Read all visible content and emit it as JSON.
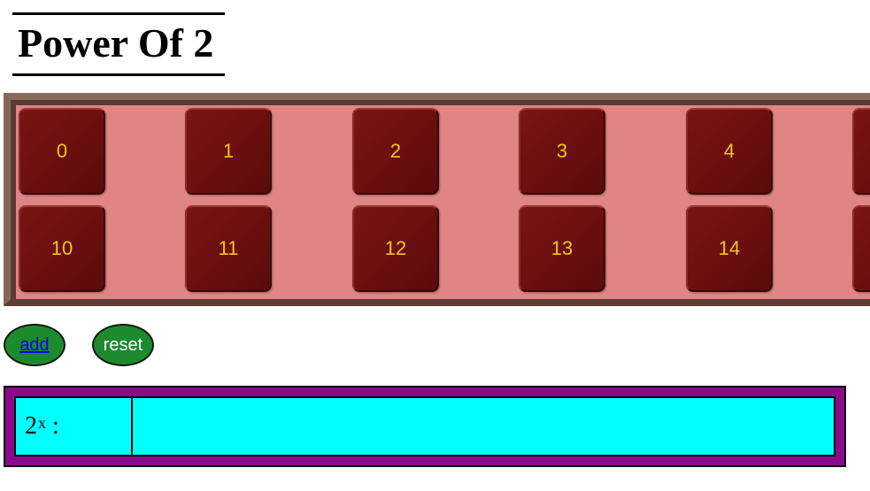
{
  "title": "Power Of 2",
  "grid": {
    "row1": [
      "0",
      "1",
      "2",
      "3",
      "4",
      ""
    ],
    "row2": [
      "10",
      "11",
      "12",
      "13",
      "14",
      ""
    ]
  },
  "buttons": {
    "add_label": "add",
    "reset_label": "reset"
  },
  "result": {
    "base": "2",
    "exponent": "x",
    "separator": " :",
    "value": ""
  },
  "colors": {
    "panel_background": "#e08585",
    "cell_background": "#6a0f0f",
    "cell_text": "#f5c51a",
    "button_background": "#1d8a2e",
    "result_frame": "#8b0a8b",
    "result_cells": "#00ffff"
  }
}
